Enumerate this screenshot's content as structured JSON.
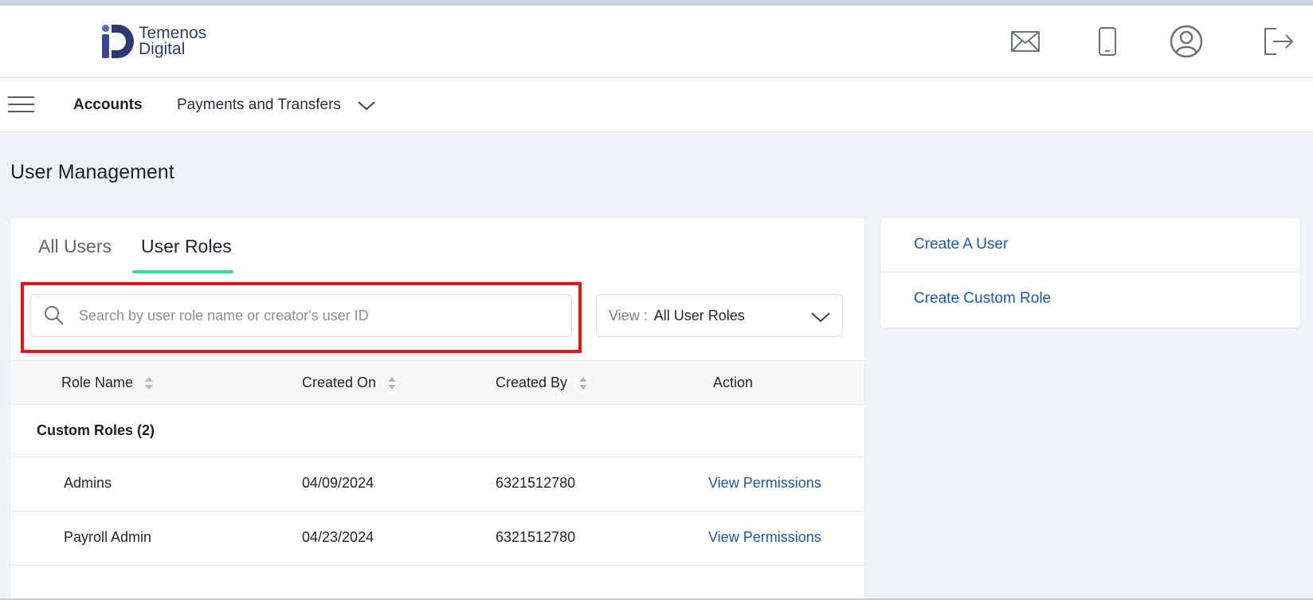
{
  "app": {
    "brand_line1": "Temenos",
    "brand_line2": "Digital",
    "brand_color": "#2d3a72"
  },
  "header": {
    "icons": [
      "mail-icon",
      "mobile-icon",
      "user-profile-icon",
      "logout-icon"
    ]
  },
  "nav": {
    "accounts_label": "Accounts",
    "payments_label": "Payments and Transfers"
  },
  "page": {
    "title": "User Management"
  },
  "tabs": {
    "all_users": "All Users",
    "user_roles": "User Roles",
    "active": "User Roles",
    "accent_color": "#3fd6a6"
  },
  "search": {
    "placeholder": "Search by user role name or creator's user ID",
    "value": ""
  },
  "view_filter": {
    "label": "View :",
    "value": "All User Roles"
  },
  "table": {
    "columns": [
      "Role Name",
      "Created On",
      "Created By",
      "Action"
    ],
    "group_label": "Custom Roles (2)",
    "rows": [
      {
        "role_name": "Admins",
        "created_on": "04/09/2024",
        "created_by": "6321512780",
        "action": "View Permissions"
      },
      {
        "role_name": "Payroll Admin",
        "created_on": "04/23/2024",
        "created_by": "6321512780",
        "action": "View Permissions"
      }
    ]
  },
  "side_actions": {
    "create_user": "Create A User",
    "create_custom_role": "Create Custom Role"
  },
  "colors": {
    "link": "#1b57b5",
    "highlight": "#e3141b"
  }
}
